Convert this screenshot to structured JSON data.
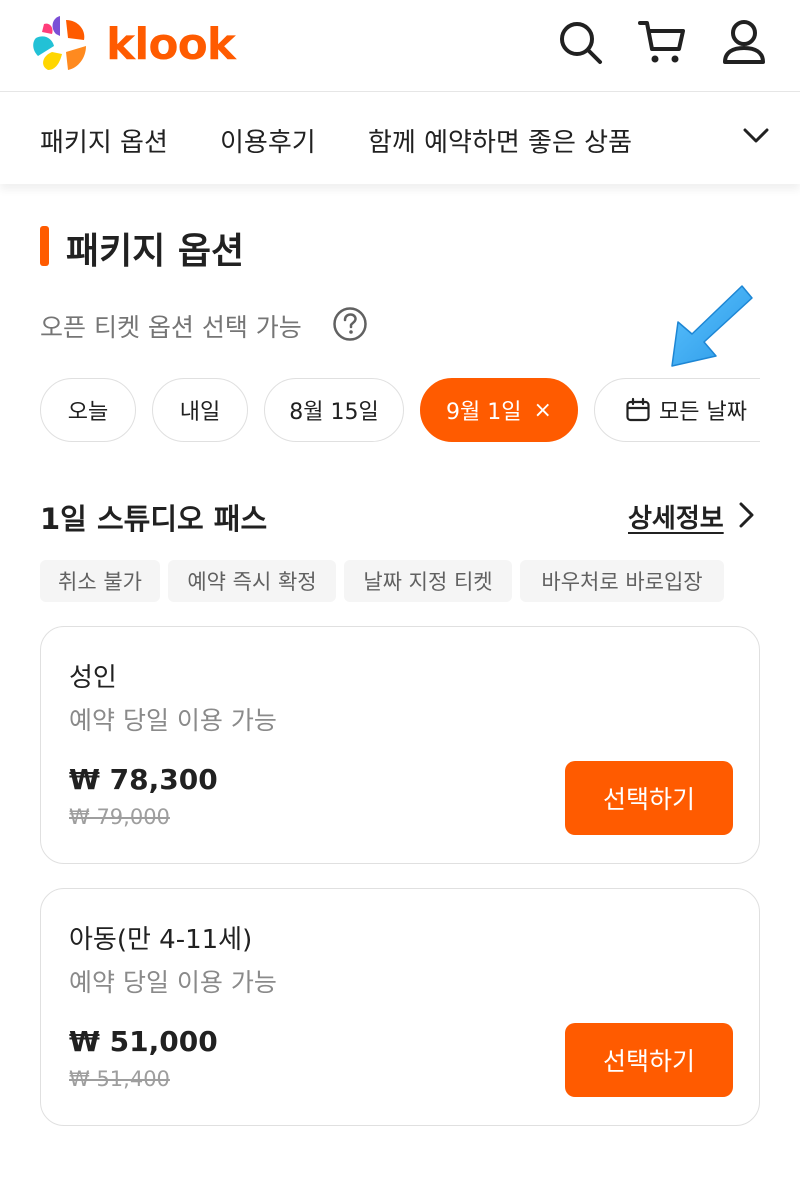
{
  "header": {
    "brand": "klook",
    "brand_color": "#ff5b00",
    "icons": [
      "search-icon",
      "cart-icon",
      "user-icon"
    ]
  },
  "tabs": [
    {
      "label": "패키지 옵션"
    },
    {
      "label": "이용후기"
    },
    {
      "label": "함께 예약하면 좋은 상품"
    }
  ],
  "section": {
    "title": "패키지 옵션",
    "open_ticket_text": "오픈 티켓 옵션 선택 가능"
  },
  "date_chips": [
    {
      "label": "오늘",
      "active": false
    },
    {
      "label": "내일",
      "active": false
    },
    {
      "label": "8월 15일",
      "active": false
    },
    {
      "label": "9월 1일",
      "active": true,
      "close_icon": "×"
    },
    {
      "label": "모든 날짜",
      "active": false,
      "icon": "calendar-icon"
    }
  ],
  "package": {
    "name": "1일 스튜디오 패스",
    "details_link": "상세정보",
    "tags": [
      "취소 불가",
      "예약 즉시 확정",
      "날짜 지정 티켓",
      "바우처로 바로입장"
    ]
  },
  "options": [
    {
      "title": "성인",
      "subtitle": "예약 당일 이용 가능",
      "price": "₩ 78,300",
      "original_price": "₩ 79,000",
      "button": "선택하기"
    },
    {
      "title": "아동(만 4-11세)",
      "subtitle": "예약 당일 이용 가능",
      "price": "₩ 51,000",
      "original_price": "₩ 51,400",
      "button": "선택하기"
    }
  ],
  "colors": {
    "accent": "#ff5b00",
    "annotation_arrow": "#35a7f0"
  }
}
